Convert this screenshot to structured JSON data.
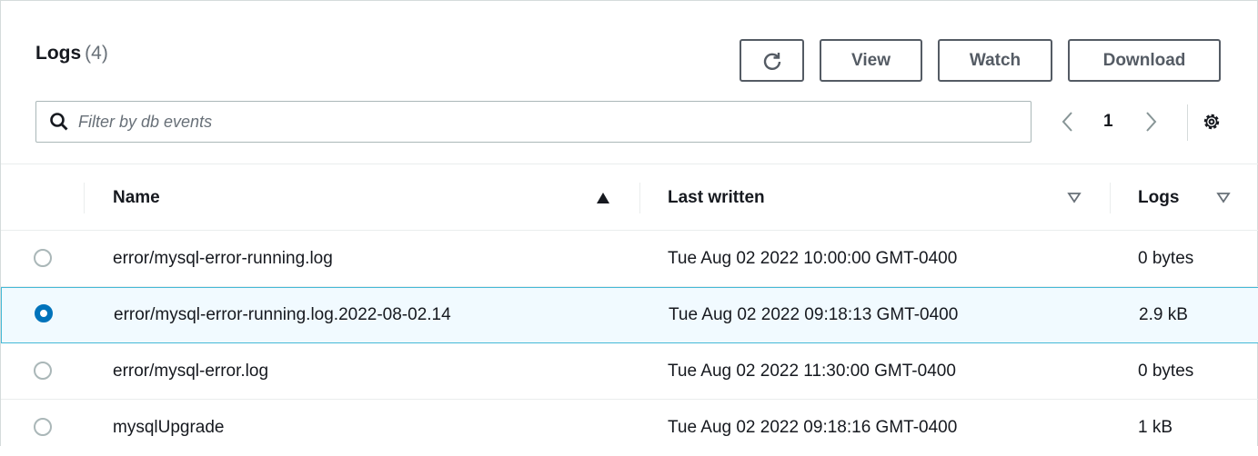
{
  "header": {
    "title": "Logs",
    "count": "(4)"
  },
  "toolbar": {
    "refresh_icon": "refresh-icon",
    "view_label": "View",
    "watch_label": "Watch",
    "download_label": "Download"
  },
  "search": {
    "placeholder": "Filter by db events",
    "value": ""
  },
  "pagination": {
    "current_page": "1"
  },
  "columns": {
    "name": "Name",
    "last_written": "Last written",
    "logs": "Logs"
  },
  "rows": [
    {
      "name": "error/mysql-error-running.log",
      "last_written": "Tue Aug 02 2022 10:00:00 GMT-0400",
      "size": "0 bytes",
      "selected": false
    },
    {
      "name": "error/mysql-error-running.log.2022-08-02.14",
      "last_written": "Tue Aug 02 2022 09:18:13 GMT-0400",
      "size": "2.9 kB",
      "selected": true
    },
    {
      "name": "error/mysql-error.log",
      "last_written": "Tue Aug 02 2022 11:30:00 GMT-0400",
      "size": "0 bytes",
      "selected": false
    },
    {
      "name": "mysqlUpgrade",
      "last_written": "Tue Aug 02 2022 09:18:16 GMT-0400",
      "size": "1 kB",
      "selected": false
    }
  ],
  "colors": {
    "accent": "#0073bb",
    "selected_row_bg": "#f1faff",
    "selected_row_border": "#44b9d6",
    "button_border": "#545b64"
  }
}
